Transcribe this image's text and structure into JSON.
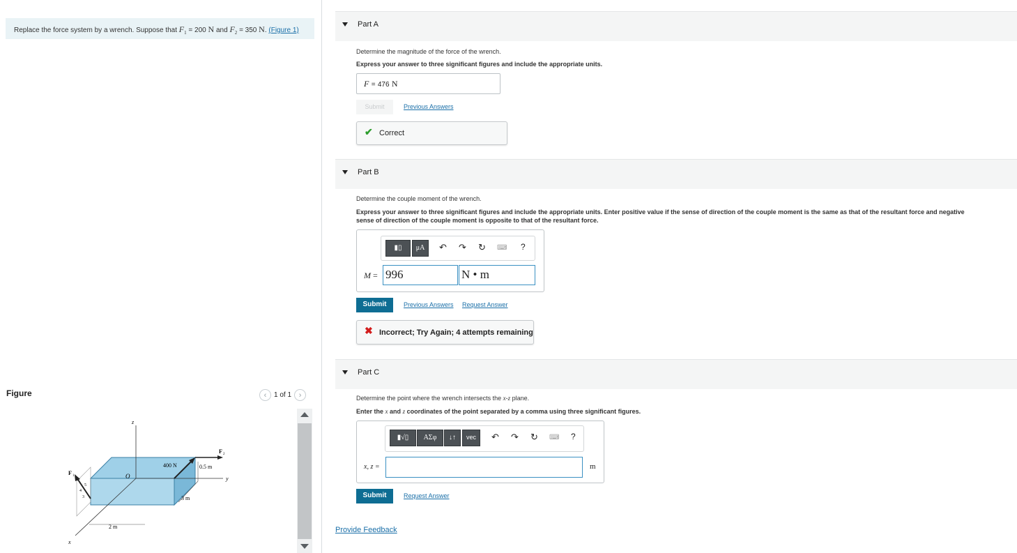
{
  "problem": {
    "text_prefix": "Replace the force system by a wrench. Suppose that",
    "f1_symbol": "F",
    "f1_sub": "1",
    "f1_value": "= 200",
    "f1_unit": "N",
    "and_text": "and",
    "f2_symbol": "F",
    "f2_sub": "2",
    "f2_value": "= 350",
    "f2_unit": "N",
    "period": ".",
    "figure_link": "(Figure 1)"
  },
  "figure": {
    "title": "Figure",
    "pager": "1 of 1",
    "prev_icon": "chevron-left-icon",
    "next_icon": "chevron-right-icon",
    "labels": {
      "z": "z",
      "y": "y",
      "x": "x",
      "o": "O",
      "f1": "F",
      "f1_sub": "1",
      "f2": "F",
      "f2_sub": "2",
      "force400": "400 N",
      "d05": "0.5 m",
      "d3": "3 m",
      "d2": "2 m",
      "r5": "5",
      "r4": "4",
      "r3": "3"
    }
  },
  "part_a": {
    "label": "Part A",
    "question": "Determine the magnitude of the force of the wrench.",
    "instruction": "Express your answer to three significant figures and include the appropriate units.",
    "answer_var": "F",
    "answer_eq": "=",
    "answer_value": "476",
    "answer_unit": "N",
    "submit_label": "Submit",
    "previous_answers": "Previous Answers",
    "feedback": "Correct",
    "feedback_icon": "check-icon"
  },
  "part_b": {
    "label": "Part B",
    "question": "Determine the couple moment of the wrench.",
    "instruction_1": "Express your answer to three significant figures and include the appropriate units. Enter positive value if the sense of direction of the couple moment is the same as that of the resultant force and negative",
    "instruction_2": "sense of direction of the couple moment is opposite to that of the resultant force.",
    "toolbar": {
      "templates_icon": "templates-icon",
      "units_label": "μA",
      "undo_icon": "undo-icon",
      "redo_icon": "redo-icon",
      "reset_icon": "reset-icon",
      "keyboard_icon": "keyboard-icon",
      "help_label": "?"
    },
    "answer_var": "M",
    "answer_eq": "=",
    "answer_value": "996",
    "answer_unit": "N • m",
    "submit_label": "Submit",
    "previous_answers": "Previous Answers",
    "request_answer": "Request Answer",
    "feedback": "Incorrect; Try Again; 4 attempts remaining",
    "feedback_icon": "x-icon"
  },
  "part_c": {
    "label": "Part C",
    "question_prefix": "Determine the point where the wrench intersects the",
    "question_plane_x": "x",
    "question_plane_sep": "-",
    "question_plane_z": "z",
    "question_suffix": "plane.",
    "instr_prefix": "Enter the",
    "instr_x": "x",
    "instr_and": "and",
    "instr_z": "z",
    "instr_suffix": "coordinates of the point separated by a comma using three significant figures.",
    "toolbar": {
      "templates_icon": "templates-icon",
      "greek_label": "ΑΣφ",
      "arrows_label": "↓↑",
      "vec_label": "vec",
      "undo_icon": "undo-icon",
      "redo_icon": "redo-icon",
      "reset_icon": "reset-icon",
      "keyboard_icon": "keyboard-icon",
      "help_label": "?"
    },
    "answer_var": "x, z =",
    "answer_value": "",
    "answer_unit": "m",
    "submit_label": "Submit",
    "request_answer": "Request Answer"
  },
  "provide_feedback": "Provide Feedback",
  "colors": {
    "accent": "#0e6d93",
    "link": "#1a6fa8",
    "correct": "#2d9d2d",
    "incorrect": "#d21c1c",
    "prompt_bg": "#e9f3f6",
    "box_top": "#9fd0e8",
    "box_front": "#aed8ec",
    "box_side": "#7ab8d8"
  }
}
